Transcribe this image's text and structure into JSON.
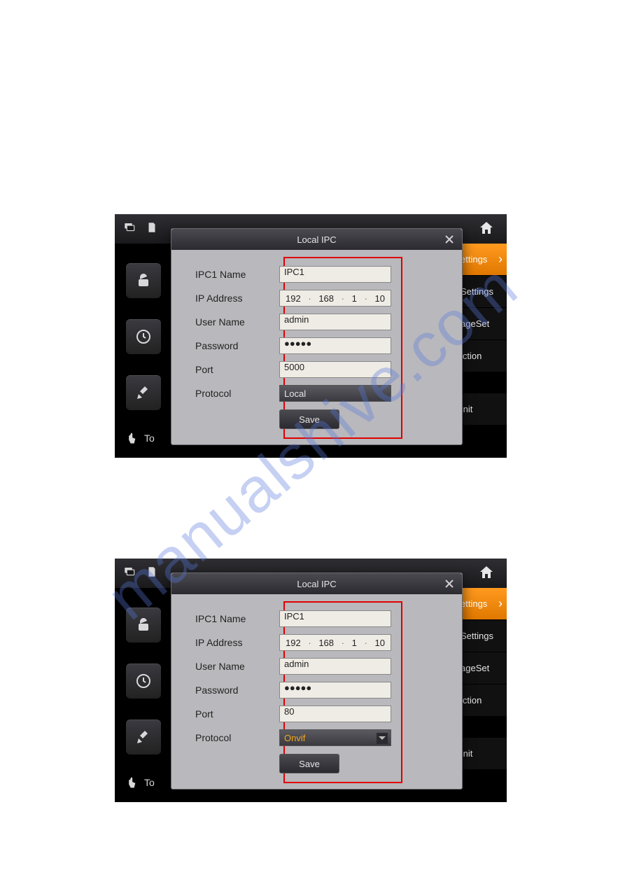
{
  "watermark": "manualshive.com",
  "dialog_title": "Local IPC",
  "labels": {
    "name": "IPC1 Name",
    "ip": "IP Address",
    "user": "User Name",
    "pass": "Password",
    "port": "Port",
    "proto": "Protocol",
    "save": "Save"
  },
  "sidemenu": {
    "active": "ettings",
    "items": [
      "Settings",
      "ageSet",
      "iction",
      "Init"
    ]
  },
  "sidebar_touch": "To",
  "screen1": {
    "name": "IPC1",
    "ip": [
      "192",
      "168",
      "1",
      "10"
    ],
    "user": "admin",
    "pass": "●●●●●",
    "port": "5000",
    "proto": "Local",
    "arrow_right": "440"
  },
  "screen2": {
    "name": "IPC1",
    "ip": [
      "192",
      "168",
      "1",
      "10"
    ],
    "user": "admin",
    "pass": "●●●●●",
    "port": "80",
    "proto": "Onvif",
    "arrow_right": "440"
  }
}
